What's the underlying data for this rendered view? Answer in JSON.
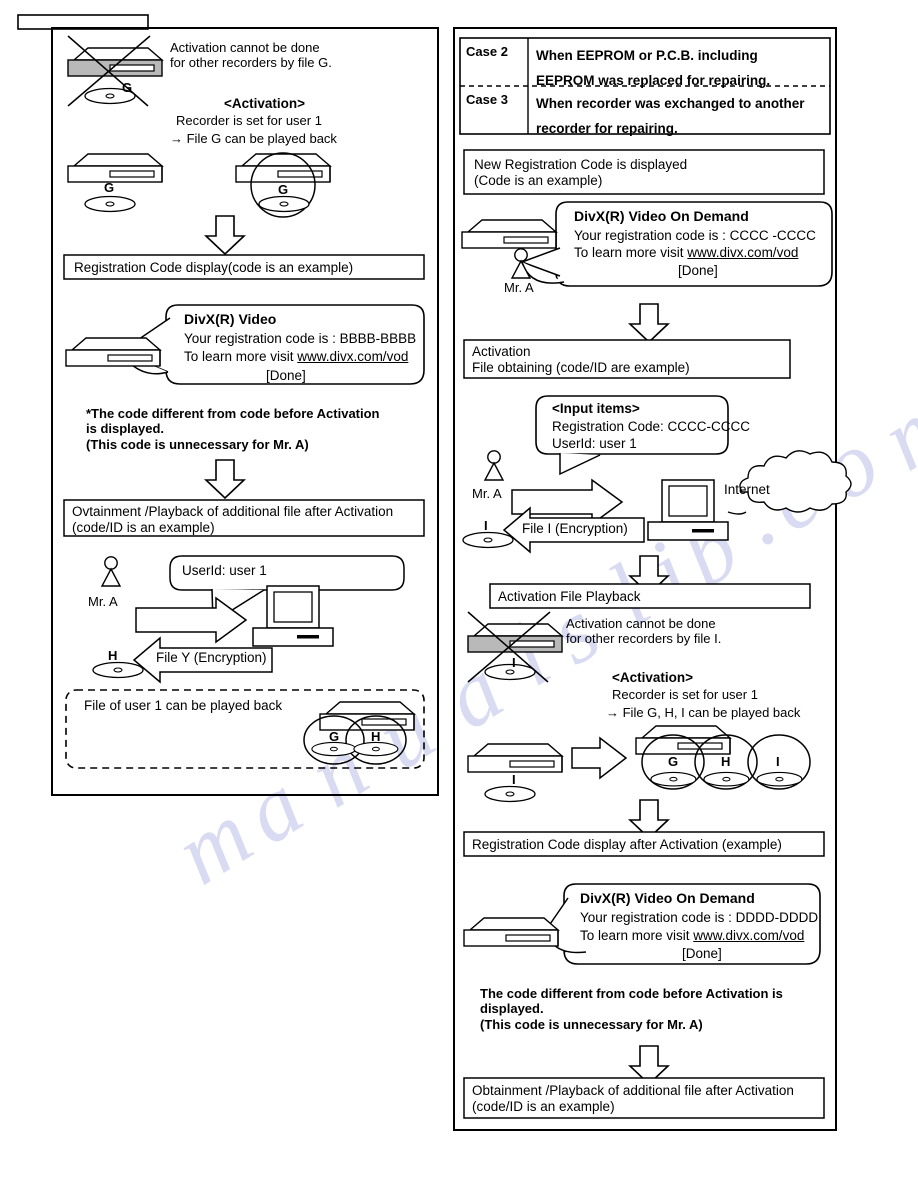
{
  "page": {
    "header_box_label": ""
  },
  "left_panel": {
    "block1": {
      "note_cannot": "Activation  cannot  be  done\nfor other recorders by file G.",
      "activation_head": "<Activation>",
      "activation_line1": "Recorder is set for user 1",
      "activation_line2": "→ File G can be played back",
      "disc_label_crossed": "G",
      "disc_label_plain": "G",
      "disc_label_circled": "G"
    },
    "reg_code_bar": "Registration Code    display(code is an example)",
    "divx_bubble": {
      "title": "DivX(R) Video",
      "line2": "Your registration code is : BBBB-BBBB",
      "line3_pre": "To learn more visit  ",
      "line3_link": "www.divx.com/vod",
      "line4": "[Done]"
    },
    "note_bold": "*The code different from code before Activation\n  is displayed.\n  (This code is unnecessary for Mr. A)",
    "obtain_bar": "Ovtainment /Playback of additional file after Activation\n(code/ID is an example)",
    "block2": {
      "userid_bubble": "UserId: user 1",
      "person_label": "Mr. A",
      "file_arrow_label": "File Y (Encryption)",
      "disc_label": "H"
    },
    "dashed_note": "File of user 1 can be played back",
    "dashed_discs": [
      "G",
      "H"
    ]
  },
  "right_panel": {
    "cases": [
      {
        "name": "Case 2",
        "text": "When EEPROM or P.C.B. including\nEEPROM was replaced for repairing."
      },
      {
        "name": "Case 3",
        "text": "When recorder was exchanged to another\nrecorder for repairing."
      }
    ],
    "new_code_bar": "New  Registration Code    is displayed\n(Code is an example)",
    "divx_bubble_top": {
      "title": "DivX(R) Video On Demand",
      "line2": "Your registration code is : CCCC -CCCC",
      "line3_pre": "To learn more visit ",
      "line3_link": "www.divx.com/vod",
      "line4": "[Done]"
    },
    "person_label_top": "Mr. A",
    "activation_bar": "Activation\nFile obtaining (code/ID are example)",
    "input_bubble": {
      "title": "<Input items>",
      "line2": "Registration Code: CCCC-CCCC",
      "line3": "UserId: user 1"
    },
    "person_label_mid": "Mr. A",
    "internet_label": "Internet",
    "file_arrow_label": "File I (Encryption)",
    "disc_label_mid": "I",
    "playback_bar": "Activation File Playback",
    "block_activation": {
      "note_cannot": "Activation  cannot   done\nfor other recorders by file I.",
      "note_cannot_full": "Activation  cannot  be   done\nfor other recorders by file I.",
      "activation_head": "<Activation>",
      "activation_line1": "Recorder is set for user 1",
      "activation_line2": "→ File G, H, I can be played back",
      "disc_label_crossed": "I",
      "disc_label_plain": "I",
      "circles": [
        "G",
        "H",
        "I"
      ]
    },
    "reg_after_bar": "Registration Code display after Activation (example)",
    "divx_bubble_bottom": {
      "title": "DivX(R) Video On Demand",
      "line2": "Your registration code is : DDDD-DDDD",
      "line3_pre": "To learn more visit ",
      "line3_link": "www.divx.com/vod",
      "line4": "[Done]"
    },
    "note_bold": "The code different from code before  Activation is\ndisplayed.\n(This code is unnecessary for Mr. A)",
    "obtain_bar": "Obtainment /Playback  of  additional  file  after  Activation\n(code/ID is an example)"
  },
  "watermark_text": [
    "m",
    "a",
    "n",
    "u",
    "a",
    "l",
    "s",
    "l",
    "i",
    "b",
    ".",
    "c",
    "o",
    "m"
  ],
  "colors": {
    "ink": "#000000",
    "recorder_shade": "#b9b9b9",
    "watermark": "#b9bfe8"
  }
}
